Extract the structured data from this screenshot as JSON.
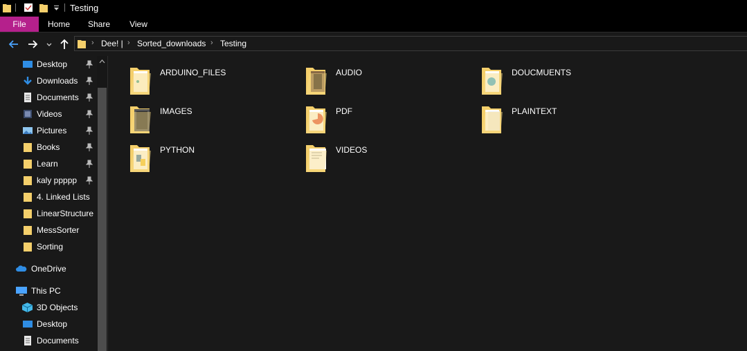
{
  "window": {
    "title": "Testing"
  },
  "ribbon": {
    "tabs": [
      {
        "label": "File"
      },
      {
        "label": "Home"
      },
      {
        "label": "Share"
      },
      {
        "label": "View"
      }
    ]
  },
  "address_bar": {
    "crumbs": [
      "Dee! |",
      "Sorted_downloads",
      "Testing"
    ]
  },
  "sidebar": {
    "quick_access": [
      {
        "label": "Desktop",
        "icon": "desktop-icon",
        "pinned": true
      },
      {
        "label": "Downloads",
        "icon": "download-icon",
        "pinned": true
      },
      {
        "label": "Documents",
        "icon": "document-icon",
        "pinned": true
      },
      {
        "label": "Videos",
        "icon": "video-icon",
        "pinned": true
      },
      {
        "label": "Pictures",
        "icon": "picture-icon",
        "pinned": true
      },
      {
        "label": "Books",
        "icon": "folder-icon",
        "pinned": true
      },
      {
        "label": "Learn",
        "icon": "folder-icon",
        "pinned": true
      },
      {
        "label": "kaly ppppp",
        "icon": "folder-icon",
        "pinned": true
      },
      {
        "label": "4. Linked Lists",
        "icon": "folder-icon",
        "pinned": false
      },
      {
        "label": "LinearStructure",
        "icon": "folder-icon",
        "pinned": false
      },
      {
        "label": "MessSorter",
        "icon": "folder-icon",
        "pinned": false
      },
      {
        "label": "Sorting",
        "icon": "folder-icon",
        "pinned": false
      }
    ],
    "onedrive": {
      "label": "OneDrive",
      "icon": "cloud-icon"
    },
    "this_pc": {
      "label": "This PC",
      "icon": "computer-icon"
    },
    "this_pc_items": [
      {
        "label": "3D Objects",
        "icon": "cube-icon"
      },
      {
        "label": "Desktop",
        "icon": "desktop-icon"
      },
      {
        "label": "Documents",
        "icon": "document-icon"
      }
    ]
  },
  "folders": [
    {
      "name": "ARDUINO_FILES"
    },
    {
      "name": "AUDIO"
    },
    {
      "name": "DOUCMUENTS"
    },
    {
      "name": "IMAGES"
    },
    {
      "name": "PDF"
    },
    {
      "name": "PLAINTEXT"
    },
    {
      "name": "PYTHON"
    },
    {
      "name": "VIDEOS"
    }
  ],
  "colors": {
    "accent_file_tab": "#b5208c",
    "folder": "#f4cf6b",
    "background": "#191919"
  }
}
